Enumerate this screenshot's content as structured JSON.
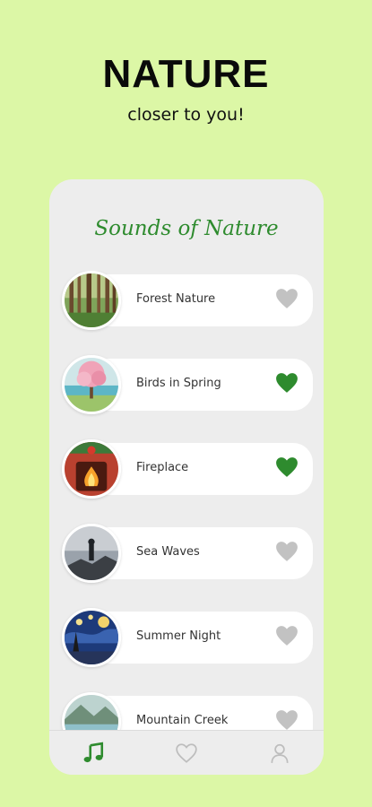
{
  "header": {
    "title": "NATURE",
    "subtitle": "closer to you!"
  },
  "card": {
    "title": "Sounds of Nature",
    "items": [
      {
        "label": "Forest Nature",
        "favorite": false,
        "icon": "forest-thumbnail"
      },
      {
        "label": "Birds in Spring",
        "favorite": true,
        "icon": "blossom-tree-thumbnail"
      },
      {
        "label": "Fireplace",
        "favorite": true,
        "icon": "fireplace-thumbnail"
      },
      {
        "label": "Sea Waves",
        "favorite": false,
        "icon": "wanderer-sea-thumbnail"
      },
      {
        "label": "Summer Night",
        "favorite": false,
        "icon": "starry-night-thumbnail"
      },
      {
        "label": "Mountain Creek",
        "favorite": false,
        "icon": "mountain-creek-thumbnail"
      }
    ]
  },
  "tabbar": {
    "tabs": [
      {
        "name": "music",
        "active": true,
        "icon": "music-note-icon"
      },
      {
        "name": "favorites",
        "active": false,
        "icon": "heart-outline-icon"
      },
      {
        "name": "profile",
        "active": false,
        "icon": "person-icon"
      }
    ]
  },
  "colors": {
    "background": "#dcf7a6",
    "card": "#ededed",
    "accent_green": "#2e8b2e",
    "heart_active": "#2e8b2e",
    "heart_inactive": "#c2c2c2",
    "tab_inactive": "#bdbdbd"
  }
}
